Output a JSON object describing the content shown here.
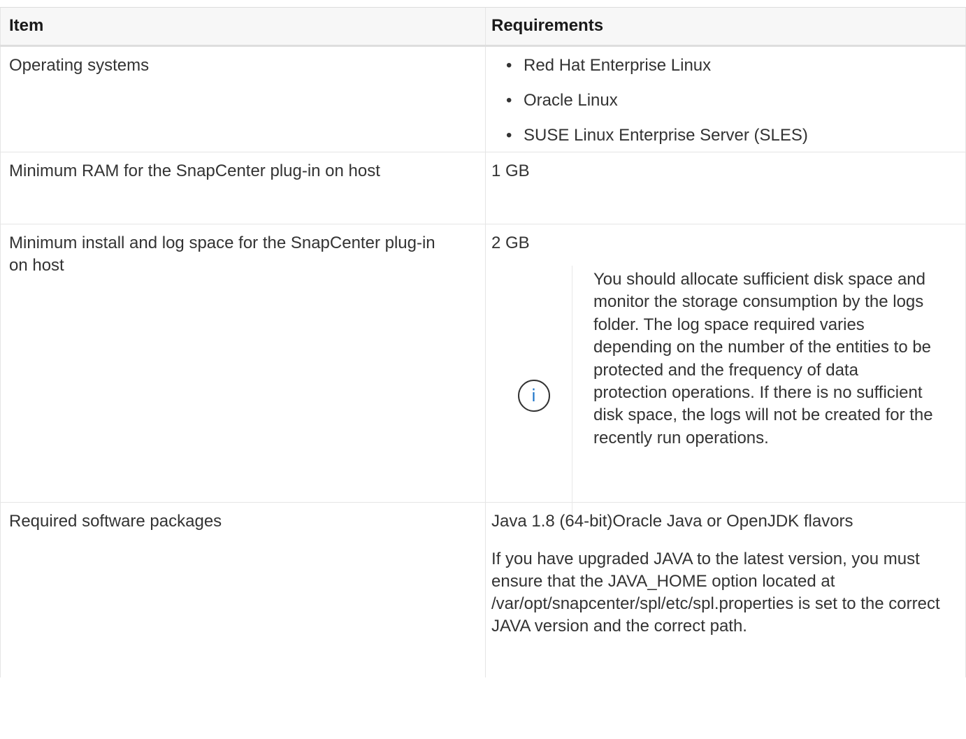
{
  "header": {
    "item": "Item",
    "requirements": "Requirements"
  },
  "rows": [
    {
      "item": "Operating systems",
      "requirements_list": [
        "Red Hat Enterprise Linux",
        "Oracle Linux",
        "SUSE Linux Enterprise Server (SLES)"
      ]
    },
    {
      "item": "Minimum RAM for the SnapCenter plug-in on host",
      "requirement": "1 GB"
    },
    {
      "item": "Minimum install and log space for the SnapCenter plug-in on host",
      "requirement": "2 GB",
      "note": {
        "icon": "info-icon",
        "icon_glyph": "i",
        "text": "You should allocate sufficient disk space and monitor the storage consumption by the logs folder. The log space required varies depending on the number of the entities to be protected and the frequency of data protection operations. If there is no sufficient disk space, the logs will not be created for the recently run operations."
      }
    },
    {
      "item": "Required software packages",
      "requirement": "Java 1.8 (64-bit)Oracle Java or OpenJDK flavors",
      "paragraph": "If you have upgraded JAVA to the latest version, you must ensure that the JAVA_HOME option located at /var/opt/snapcenter/spl/etc/spl.properties is set to the correct JAVA version and the correct path."
    }
  ],
  "bullet_glyph": "•",
  "colors": {
    "text": "#333333",
    "header_bg": "#f7f7f7",
    "border": "#e5e5e5",
    "info_icon": "#1a73c8"
  }
}
